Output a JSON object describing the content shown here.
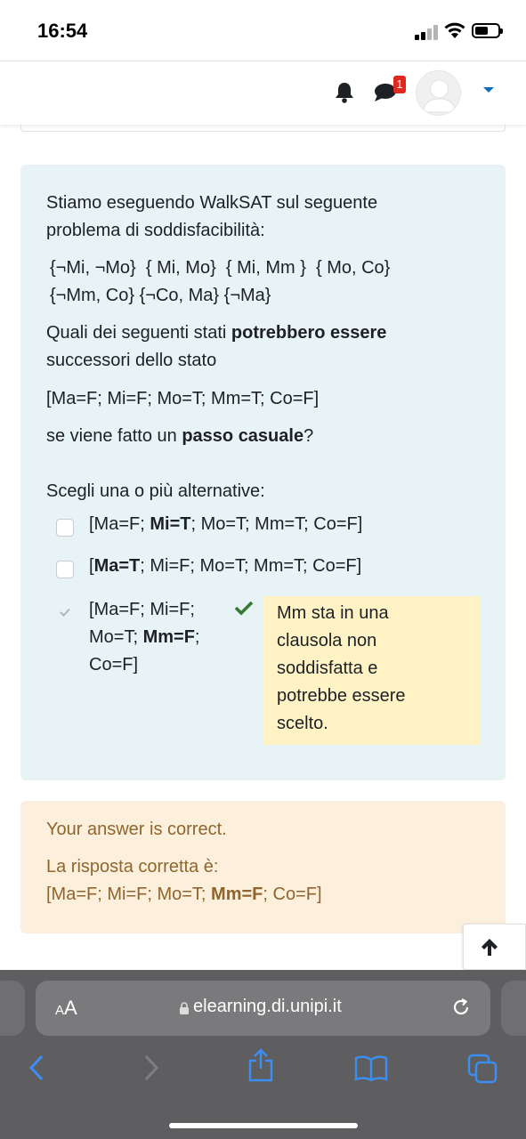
{
  "status_bar": {
    "time": "16:54"
  },
  "header": {
    "notification_badge": "1",
    "icons": [
      "bell-icon",
      "chat-icon",
      "avatar",
      "caret-down-icon"
    ],
    "accent_color": "#0f6cbf",
    "badge_color": "#e0281f"
  },
  "question": {
    "intro_line1": "Stiamo eseguendo WalkSAT sul seguente",
    "intro_line2": "problema di soddisfacibilità:",
    "clauses_line1": "{¬Mi, ¬Mo}  { Mi, Mo}  { Mi, Mm }  { Mo, Co}",
    "clauses_line2": "{¬Mm, Co} {¬Co, Ma} {¬Ma}",
    "prompt_prefix": "Quali dei seguenti stati ",
    "prompt_bold": "potrebbero essere",
    "prompt_line2": "successori dello stato",
    "state": "[Ma=F; Mi=F; Mo=T; Mm=T; Co=F]",
    "step_prefix": "se viene fatto un ",
    "step_bold": "passo casuale",
    "step_suffix": "?",
    "choose_label": "Scegli una o più alternative:",
    "options": [
      {
        "pre": "[Ma=F; ",
        "bold": "Mi=T",
        "post": "; Mo=T; Mm=T; Co=F]",
        "checked": false
      },
      {
        "pre": "[",
        "bold": "Ma=T",
        "post": "; Mi=F; Mo=T; Mm=T; Co=F]",
        "checked": false
      },
      {
        "line1": "[Ma=F; Mi=F;",
        "line2_pre": "Mo=T; ",
        "line2_bold": "Mm=F",
        "line2_post": ";",
        "line3": "Co=F]",
        "checked": true,
        "correct": true
      }
    ],
    "feedback_lines": [
      "Mm sta in una",
      "clausola non",
      "soddisfatta e",
      "potrebbe essere",
      "scelto."
    ]
  },
  "answer": {
    "status": "Your answer is correct.",
    "label": "La risposta corretta è:",
    "pre": "[Ma=F; Mi=F; Mo=T; ",
    "bold": "Mm=F",
    "post": "; Co=F]"
  },
  "safari": {
    "aa_small": "A",
    "aa_large": "A",
    "url": "elearning.di.unipi.it"
  }
}
